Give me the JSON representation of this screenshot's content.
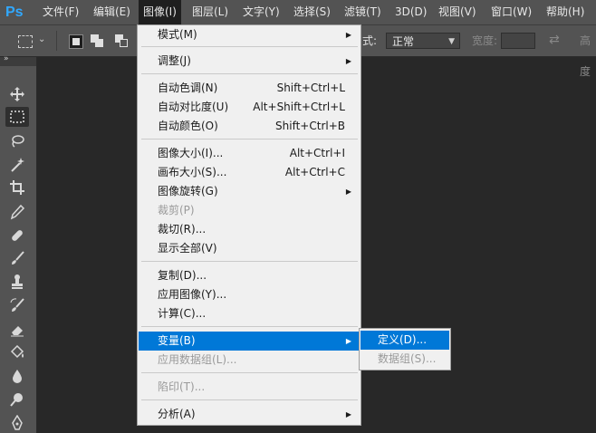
{
  "app": {
    "logo": "Ps"
  },
  "menubar": {
    "items": [
      {
        "label": "文件(F)"
      },
      {
        "label": "编辑(E)"
      },
      {
        "label": "图像(I)"
      },
      {
        "label": "图层(L)"
      },
      {
        "label": "文字(Y)"
      },
      {
        "label": "选择(S)"
      },
      {
        "label": "滤镜(T)"
      },
      {
        "label": "3D(D)"
      },
      {
        "label": "视图(V)"
      },
      {
        "label": "窗口(W)"
      },
      {
        "label": "帮助(H)"
      }
    ]
  },
  "options": {
    "style_label": "式:",
    "style_value": "正常",
    "width_label": "宽度:",
    "height_label": "高度"
  },
  "image_menu": {
    "items": [
      {
        "label": "模式(M)",
        "shortcut": "",
        "submenu": true
      },
      {
        "label": "调整(J)",
        "shortcut": "",
        "submenu": true
      },
      {
        "label": "自动色调(N)",
        "shortcut": "Shift+Ctrl+L"
      },
      {
        "label": "自动对比度(U)",
        "shortcut": "Alt+Shift+Ctrl+L"
      },
      {
        "label": "自动颜色(O)",
        "shortcut": "Shift+Ctrl+B"
      },
      {
        "label": "图像大小(I)...",
        "shortcut": "Alt+Ctrl+I"
      },
      {
        "label": "画布大小(S)...",
        "shortcut": "Alt+Ctrl+C"
      },
      {
        "label": "图像旋转(G)",
        "shortcut": "",
        "submenu": true
      },
      {
        "label": "裁剪(P)",
        "shortcut": "",
        "disabled": true
      },
      {
        "label": "裁切(R)...",
        "shortcut": ""
      },
      {
        "label": "显示全部(V)",
        "shortcut": ""
      },
      {
        "label": "复制(D)...",
        "shortcut": ""
      },
      {
        "label": "应用图像(Y)...",
        "shortcut": ""
      },
      {
        "label": "计算(C)...",
        "shortcut": ""
      },
      {
        "label": "变量(B)",
        "shortcut": "",
        "submenu": true,
        "highlighted": true
      },
      {
        "label": "应用数据组(L)...",
        "shortcut": "",
        "disabled": true
      },
      {
        "label": "陷印(T)...",
        "shortcut": "",
        "disabled": true
      },
      {
        "label": "分析(A)",
        "shortcut": "",
        "submenu": true
      }
    ]
  },
  "variables_submenu": {
    "items": [
      {
        "label": "定义(D)...",
        "highlighted": true
      },
      {
        "label": "数据组(S)...",
        "disabled": true
      }
    ]
  },
  "colors": {
    "highlight": "#0078d7",
    "logo": "#31a8ff",
    "menu_bg": "#f0f0f0",
    "chrome": "#535353",
    "canvas": "#282828"
  }
}
